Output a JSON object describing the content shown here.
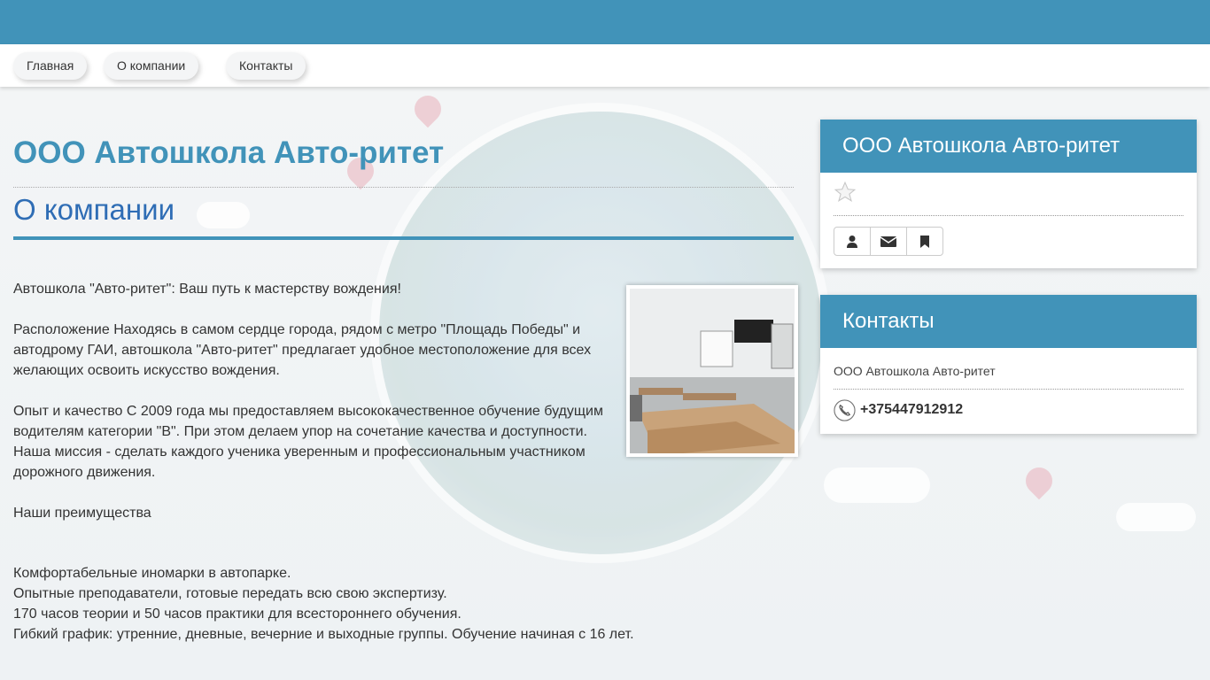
{
  "nav": {
    "items": [
      {
        "label": "Главная"
      },
      {
        "label": "О компании"
      },
      {
        "label": "Контакты"
      }
    ]
  },
  "main": {
    "title": "ООО Автошкола Авто-ритет",
    "subtitle": "О компании",
    "paragraphs": [
      "Автошкола \"Авто-ритет\": Ваш путь к мастерству вождения!",
      "Расположение Находясь в самом сердце города, рядом с метро \"Площадь Победы\" и автодрому ГАИ, автошкола \"Авто-ритет\" предлагает удобное местоположение для всех желающих освоить искусство вождения.",
      "Опыт и качество С 2009 года мы предоставляем высококачественное обучение будущим водителям категории \"B\". При этом делаем упор на сочетание качества и доступности. Наша миссия - сделать каждого ученика уверенным и профессиональным участником дорожного движения.",
      "Наши преимущества"
    ],
    "advantages": [
      "Комфортабельные иномарки в автопарке.",
      "Опытные преподаватели, готовые передать всю свою экспертизу.",
      "170 часов теории и 50 часов практики для всестороннего обучения.",
      "Гибкий график: утренние, дневные, вечерние и выходные группы. Обучение начиная с 16 лет."
    ]
  },
  "company_panel": {
    "title": "ООО Автошкола Авто-ритет",
    "rating_icon": "star-icon",
    "buttons": [
      "user-icon",
      "envelope-icon",
      "bookmark-icon"
    ]
  },
  "contacts_panel": {
    "title": "Контакты",
    "company": "ООО Автошкола Авто-ритет",
    "phone": "+375447912912"
  },
  "colors": {
    "accent": "#4193b9",
    "subtitle": "#2f6db5"
  }
}
